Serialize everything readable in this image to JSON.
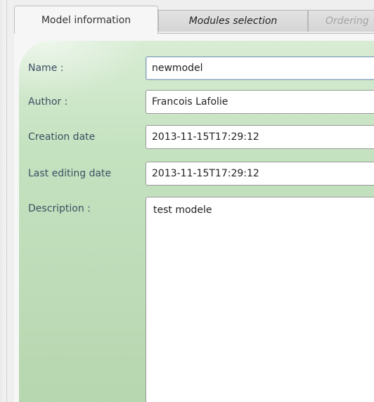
{
  "tabs": [
    {
      "label": "Model information"
    },
    {
      "label": "Modules selection"
    },
    {
      "label": "Ordering"
    }
  ],
  "form": {
    "name_label": "Name :",
    "name_value": "newmodel",
    "author_label": "Author :",
    "author_value": "Francois Lafolie",
    "creation_label": "Creation date",
    "creation_value": "2013-11-15T17:29:12",
    "edit_label": "Last editing date",
    "edit_value": "2013-11-15T17:29:12",
    "description_label": "Description :",
    "description_value": "test modele"
  },
  "colors": {
    "panel_green": "#c4e2bf",
    "label_text": "#3c4f63"
  }
}
